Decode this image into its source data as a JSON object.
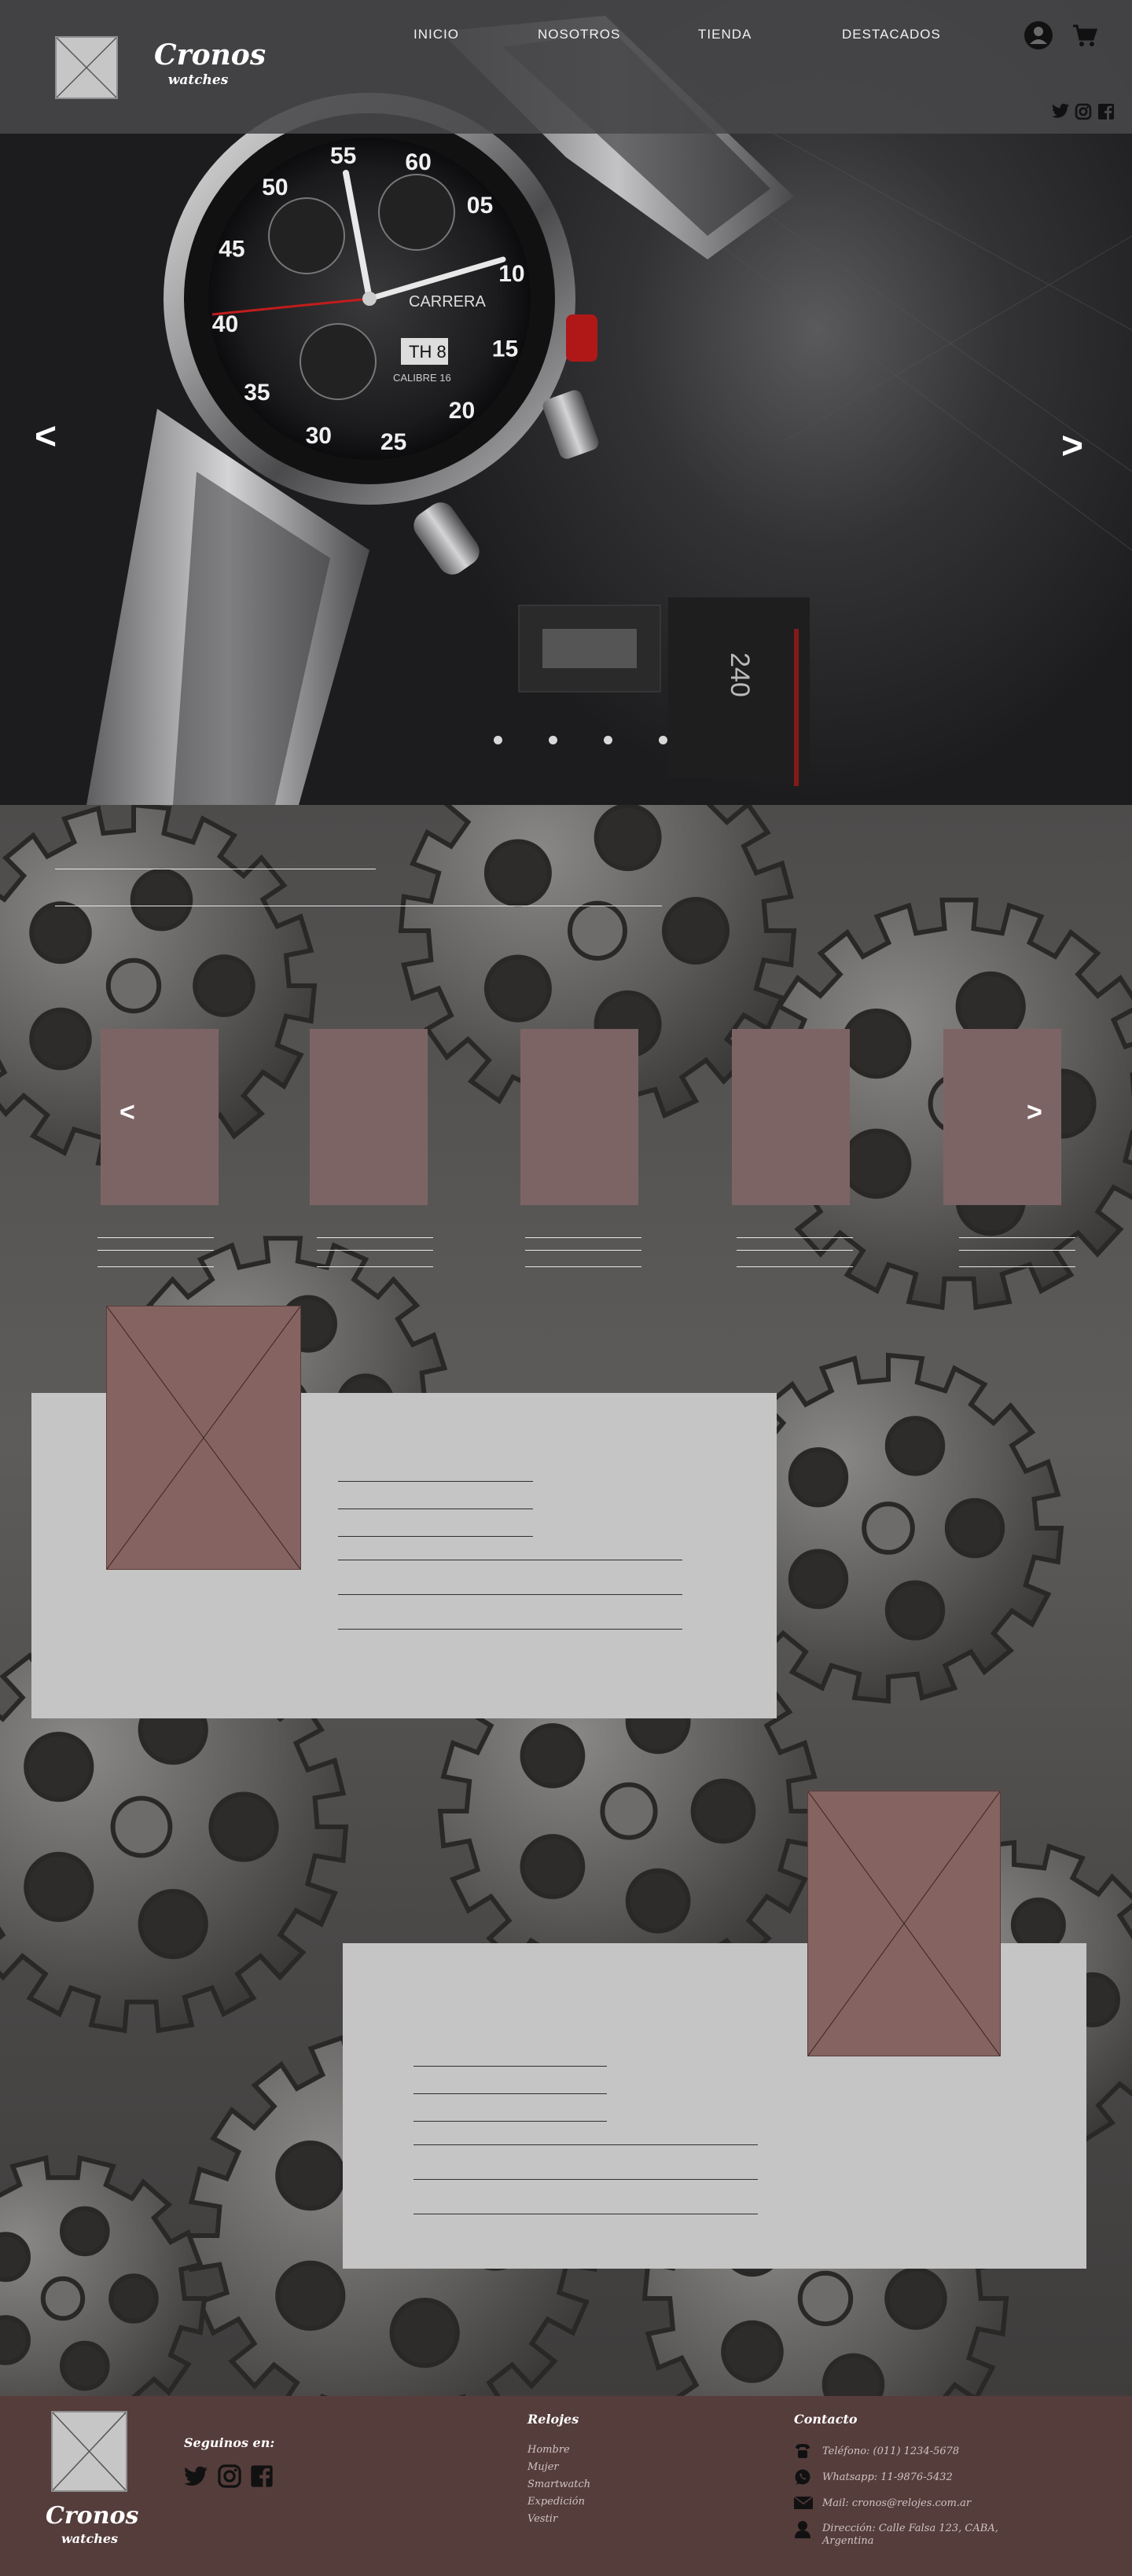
{
  "brand": {
    "name": "Cronos",
    "sub": "watches"
  },
  "nav": {
    "items": [
      {
        "label": "INICIO"
      },
      {
        "label": "NOSOTROS"
      },
      {
        "label": "TIENDA"
      },
      {
        "label": "DESTACADOS"
      }
    ]
  },
  "header_icons": [
    "user-circle-icon",
    "cart-icon"
  ],
  "social": [
    "twitter-icon",
    "instagram-icon",
    "facebook-icon"
  ],
  "hero": {
    "prev": "<",
    "next": ">",
    "slides": 4,
    "watch_dial": {
      "brand": "CARRERA",
      "calibre": "CALIBRE 16",
      "numerals": [
        "60",
        "05",
        "10",
        "15",
        "20",
        "25",
        "30",
        "35",
        "40",
        "45",
        "50",
        "55"
      ]
    }
  },
  "products": {
    "prev": "<",
    "next": ">"
  },
  "footer": {
    "follow_title": "Seguinos en:",
    "relojes_title": "Relojes",
    "relojes": [
      "Hombre",
      "Mujer",
      "Smartwatch",
      "Expedición",
      "Vestir"
    ],
    "contacto_title": "Contacto",
    "contacto": [
      {
        "icon": "phone-icon",
        "text": "Teléfono: (011) 1234-5678"
      },
      {
        "icon": "whatsapp-icon",
        "text": "Whatsapp: 11-9876-5432"
      },
      {
        "icon": "mail-icon",
        "text": "Mail: cronos@relojes.com.ar"
      },
      {
        "icon": "location-icon",
        "text": "Dirección: Calle Falsa 123, CABA, Argentina"
      }
    ]
  },
  "colors": {
    "accent": "#7c6465",
    "footer": "#553d3c",
    "panel": "#c5c5c5",
    "header": "#48484a"
  }
}
